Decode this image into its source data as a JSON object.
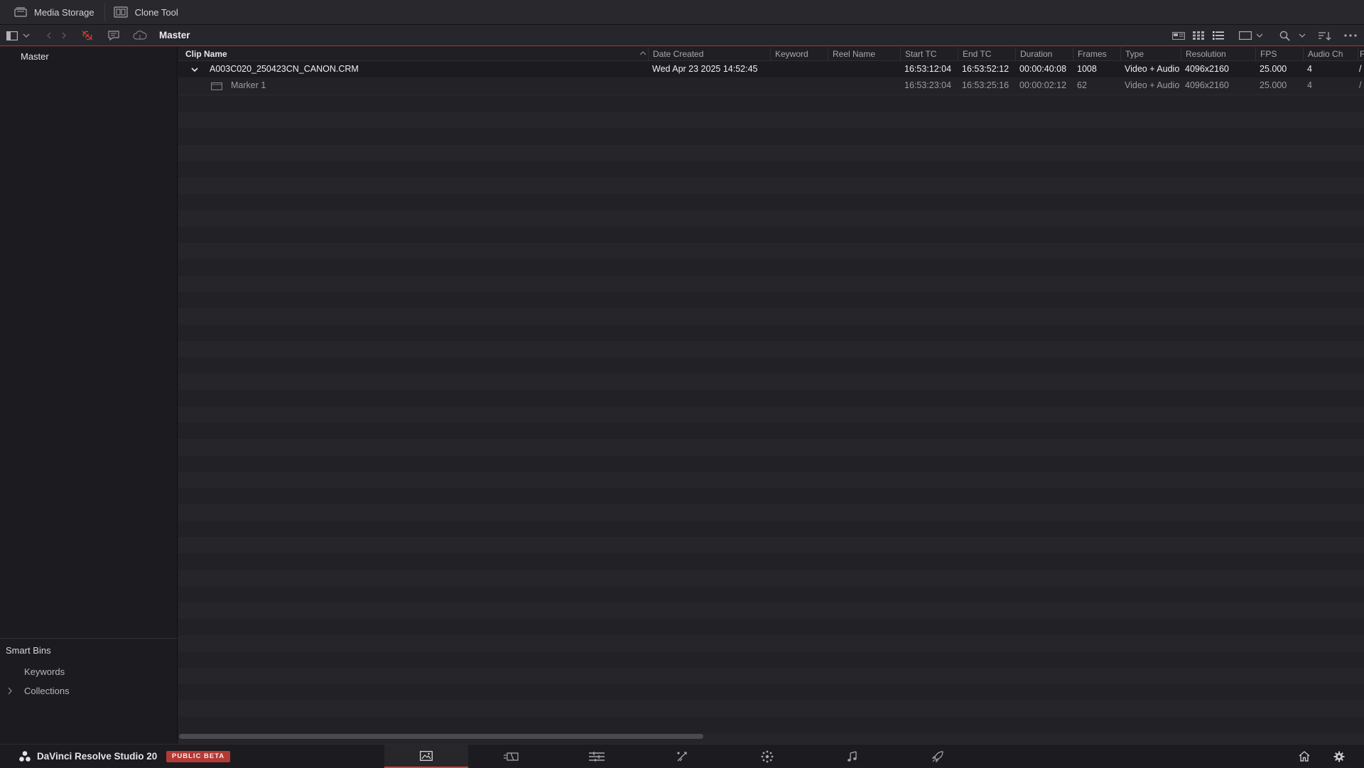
{
  "top_tabs": [
    {
      "label": "Media Storage",
      "icon": "media-storage-icon"
    },
    {
      "label": "Clone Tool",
      "icon": "clone-tool-icon"
    }
  ],
  "toolbar": {
    "bin_title": "Master"
  },
  "sidebar": {
    "master_label": "Master",
    "smart_bins_title": "Smart Bins",
    "smart_bins_items": [
      "Keywords",
      "Collections"
    ]
  },
  "table": {
    "columns": [
      "Clip Name",
      "Date Created",
      "Keyword",
      "Reel Name",
      "Start TC",
      "End TC",
      "Duration",
      "Frames",
      "Type",
      "Resolution",
      "FPS",
      "Audio Ch",
      "F"
    ],
    "rows": [
      {
        "kind": "clip",
        "clip_name": "A003C020_250423CN_CANON.CRM",
        "date_created": "Wed Apr 23 2025 14:52:45",
        "keyword": "",
        "reel_name": "",
        "start_tc": "16:53:12:04",
        "end_tc": "16:53:52:12",
        "duration": "00:00:40:08",
        "frames": "1008",
        "type": "Video + Audio",
        "resolution": "4096x2160",
        "fps": "25.000",
        "audio_ch": "4",
        "extra": "/"
      },
      {
        "kind": "marker",
        "clip_name": "Marker 1",
        "date_created": "",
        "keyword": "",
        "reel_name": "",
        "start_tc": "16:53:23:04",
        "end_tc": "16:53:25:16",
        "duration": "00:00:02:12",
        "frames": "62",
        "type": "Video + Audio",
        "resolution": "4096x2160",
        "fps": "25.000",
        "audio_ch": "4",
        "extra": "/"
      }
    ]
  },
  "bottom_bar": {
    "app_name": "DaVinci Resolve Studio 20",
    "badge": "PUBLIC BETA",
    "pages": [
      "media",
      "cut",
      "edit",
      "fusion",
      "color",
      "fairlight",
      "deliver"
    ],
    "active_page": "media"
  },
  "colors": {
    "accent_red": "#d64035",
    "badge_red": "#b23a35",
    "background": "#1f1f23"
  }
}
